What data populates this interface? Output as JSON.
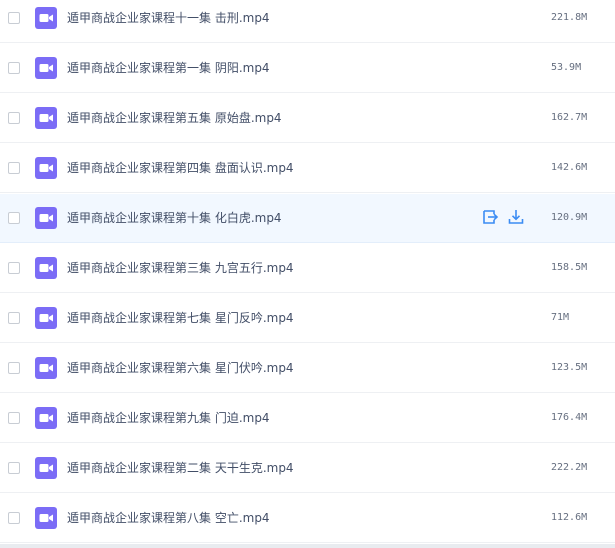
{
  "files": [
    {
      "name": "遁甲商战企业家课程十一集 击刑.mp4",
      "size": "221.8M",
      "icon": "video-file-icon"
    },
    {
      "name": "遁甲商战企业家课程第一集 阴阳.mp4",
      "size": "53.9M",
      "icon": "video-file-icon"
    },
    {
      "name": "遁甲商战企业家课程第五集 原始盘.mp4",
      "size": "162.7M",
      "icon": "video-file-icon"
    },
    {
      "name": "遁甲商战企业家课程第四集 盘面认识.mp4",
      "size": "142.6M",
      "icon": "video-file-icon"
    },
    {
      "name": "遁甲商战企业家课程第十集 化白虎.mp4",
      "size": "120.9M",
      "icon": "video-file-icon",
      "hovered": true
    },
    {
      "name": "遁甲商战企业家课程第三集 九宫五行.mp4",
      "size": "158.5M",
      "icon": "video-file-icon"
    },
    {
      "name": "遁甲商战企业家课程第七集 星门反吟.mp4",
      "size": "71M",
      "icon": "video-file-icon"
    },
    {
      "name": "遁甲商战企业家课程第六集 星门伏吟.mp4",
      "size": "123.5M",
      "icon": "video-file-icon"
    },
    {
      "name": "遁甲商战企业家课程第九集 门迫.mp4",
      "size": "176.4M",
      "icon": "video-file-icon"
    },
    {
      "name": "遁甲商战企业家课程第二集 天干生克.mp4",
      "size": "222.2M",
      "icon": "video-file-icon"
    },
    {
      "name": "遁甲商战企业家课程第八集 空亡.mp4",
      "size": "112.6M",
      "icon": "video-file-icon"
    }
  ],
  "row_actions": {
    "share_icon": "share-icon",
    "download_icon": "download-icon"
  },
  "colors": {
    "video_icon": "#7b6cf6",
    "action_icon": "#3b8cf3",
    "hover_row": "#f2f8ff"
  }
}
